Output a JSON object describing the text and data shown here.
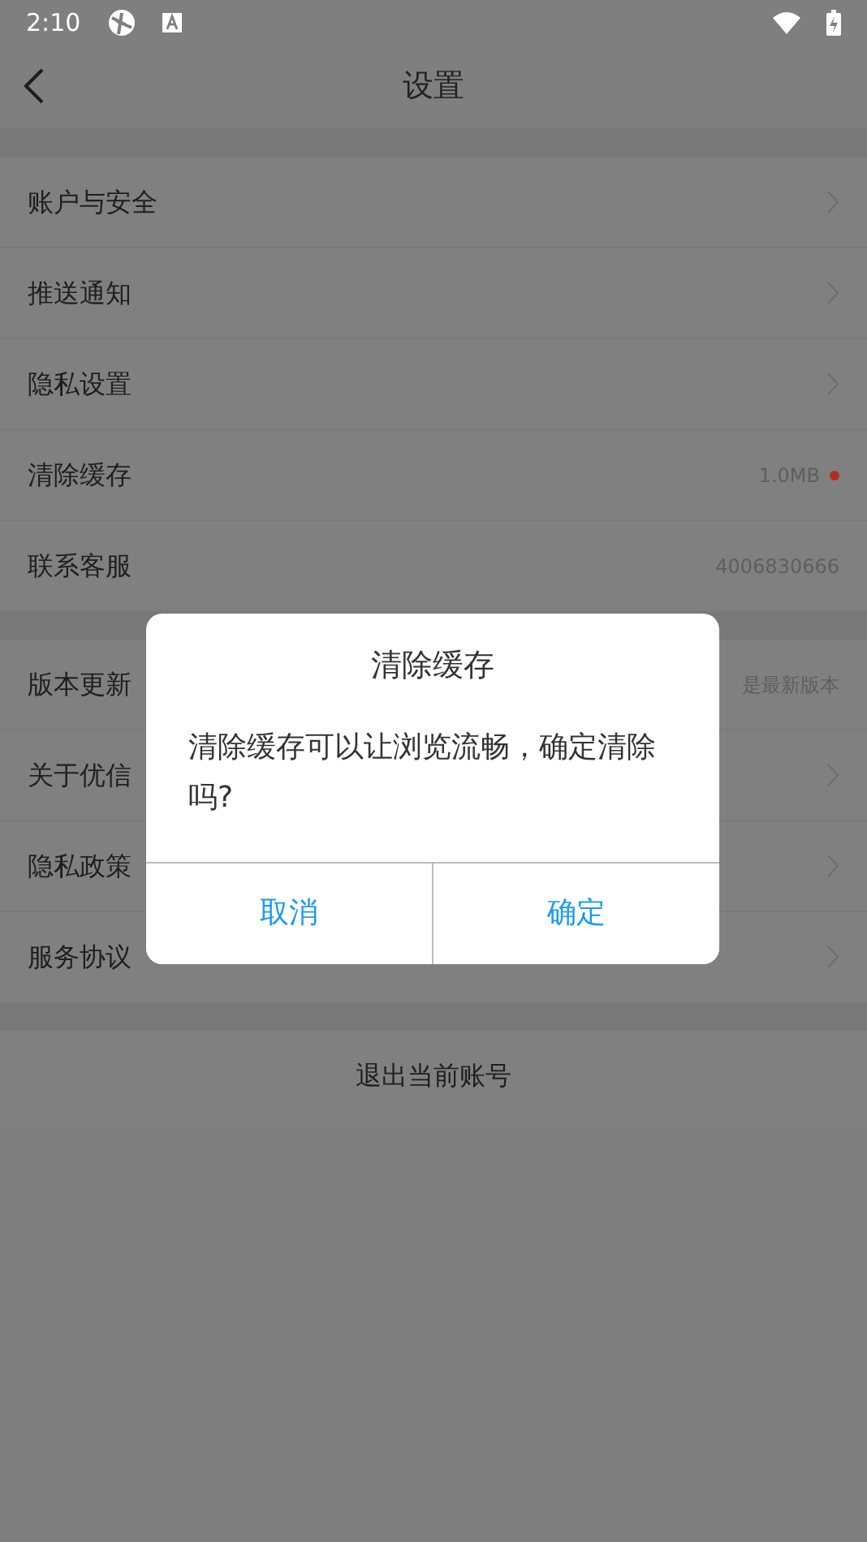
{
  "status_bar": {
    "time": "2:10"
  },
  "header": {
    "title": "设置"
  },
  "sections": [
    {
      "items": [
        {
          "label": "账户与安全",
          "kind": "link"
        },
        {
          "label": "推送通知",
          "kind": "link"
        },
        {
          "label": "隐私设置",
          "kind": "link"
        },
        {
          "label": "清除缓存",
          "kind": "value",
          "value": "1.0MB",
          "dot": true
        },
        {
          "label": "联系客服",
          "kind": "value",
          "value": "4006830666"
        }
      ]
    },
    {
      "items": [
        {
          "label": "版本更新",
          "kind": "value",
          "value": "是最新版本"
        },
        {
          "label": "关于优信",
          "kind": "link"
        },
        {
          "label": "隐私政策",
          "kind": "link"
        },
        {
          "label": "服务协议",
          "kind": "link"
        }
      ]
    }
  ],
  "logout": "退出当前账号",
  "dialog": {
    "title": "清除缓存",
    "message": "清除缓存可以让浏览流畅，确定清除吗?",
    "buttons": [
      "取消",
      "确定"
    ]
  }
}
